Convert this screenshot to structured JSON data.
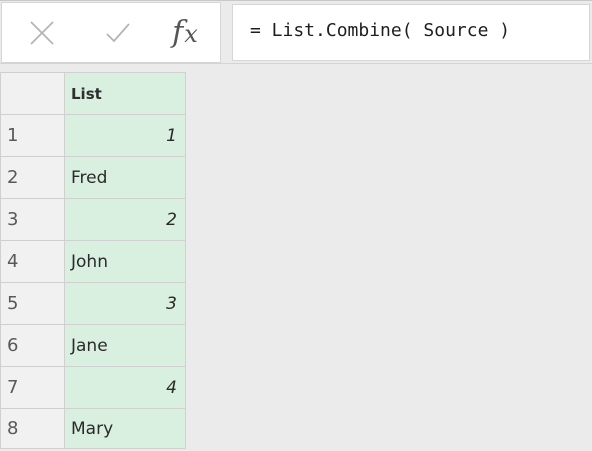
{
  "formula_bar": {
    "cancel_icon": "x-icon",
    "enter_icon": "check-icon",
    "fx_f": "f",
    "fx_x": "x",
    "formula": "= List.Combine( Source )"
  },
  "grid": {
    "column_header": "List",
    "rows": [
      {
        "index": "1",
        "value": "1",
        "kind": "number"
      },
      {
        "index": "2",
        "value": "Fred",
        "kind": "text"
      },
      {
        "index": "3",
        "value": "2",
        "kind": "number"
      },
      {
        "index": "4",
        "value": "John",
        "kind": "text"
      },
      {
        "index": "5",
        "value": "3",
        "kind": "number"
      },
      {
        "index": "6",
        "value": "Jane",
        "kind": "text"
      },
      {
        "index": "7",
        "value": "4",
        "kind": "number"
      },
      {
        "index": "8",
        "value": "Mary",
        "kind": "text"
      }
    ]
  },
  "colors": {
    "column_fill": "#d9f0e0",
    "background": "#ebebeb"
  }
}
